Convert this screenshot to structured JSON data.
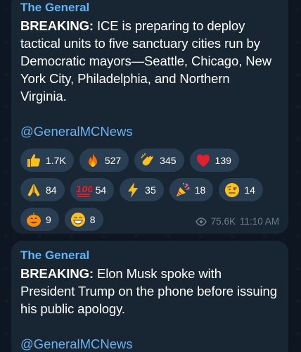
{
  "posts": [
    {
      "sender": "The General",
      "bold_prefix": "BREAKING:",
      "body": " ICE is preparing to deploy tactical units to five sanctuary cities run by Democratic mayors—Seattle, Chicago, New York City, Philadelphia, and Northern Virginia.",
      "link": "@GeneralMCNews",
      "reactions": [
        {
          "icon": "thumbs-up-icon",
          "count": "1.7K"
        },
        {
          "icon": "fire-icon",
          "count": "527"
        },
        {
          "icon": "clapping-hands-icon",
          "count": "345"
        },
        {
          "icon": "red-heart-icon",
          "count": "139"
        },
        {
          "icon": "folded-hands-icon",
          "count": "84"
        },
        {
          "icon": "hundred-points-icon",
          "count": "54"
        },
        {
          "icon": "lightning-icon",
          "count": "35"
        },
        {
          "icon": "party-popper-icon",
          "count": "18"
        },
        {
          "icon": "raised-eyebrow-face-icon",
          "count": "14"
        },
        {
          "icon": "jack-o-lantern-icon",
          "count": "9"
        },
        {
          "icon": "grinning-face-icon",
          "count": "8"
        }
      ],
      "views": "75.6K",
      "time": "11:10 AM"
    },
    {
      "sender": "The General",
      "bold_prefix": "BREAKING:",
      "body": " Elon Musk spoke with President Trump on the phone before issuing his public apology.",
      "link": "@GeneralMCNews"
    }
  ]
}
